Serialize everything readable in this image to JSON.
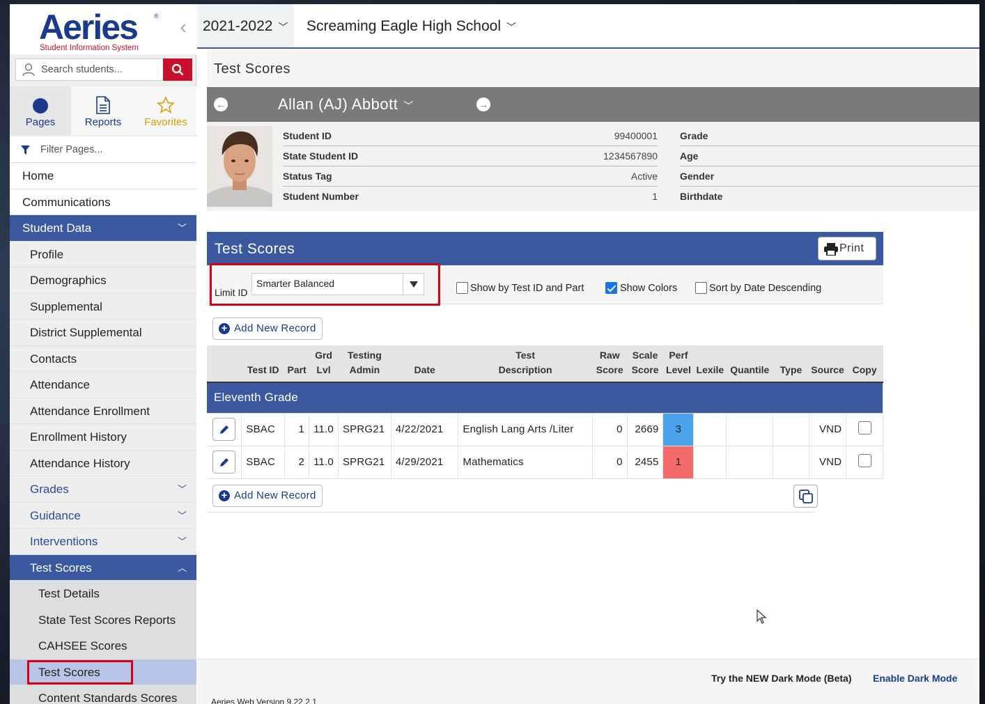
{
  "app": {
    "logo_text": "Aeries",
    "logo_subtitle": "Student Information System",
    "logo_reg": "®"
  },
  "search": {
    "placeholder": "Search students..."
  },
  "nav_tabs": {
    "pages": "Pages",
    "reports": "Reports",
    "favorites": "Favorites"
  },
  "filter_pages": "Filter Pages...",
  "sidebar": {
    "items": [
      {
        "label": "Home"
      },
      {
        "label": "Communications"
      },
      {
        "label": "Student Data"
      },
      {
        "label": "Profile"
      },
      {
        "label": "Demographics"
      },
      {
        "label": "Supplemental"
      },
      {
        "label": "District Supplemental"
      },
      {
        "label": "Contacts"
      },
      {
        "label": "Attendance"
      },
      {
        "label": "Attendance Enrollment"
      },
      {
        "label": "Enrollment History"
      },
      {
        "label": "Attendance History"
      },
      {
        "label": "Grades"
      },
      {
        "label": "Guidance"
      },
      {
        "label": "Interventions"
      },
      {
        "label": "Test Scores"
      },
      {
        "label": "Test Details"
      },
      {
        "label": "State Test Scores Reports"
      },
      {
        "label": "CAHSEE Scores"
      },
      {
        "label": "Test Scores"
      },
      {
        "label": "Content Standards Scores"
      }
    ]
  },
  "topbar": {
    "year": "2021-2022",
    "school": "Screaming Eagle High School"
  },
  "page_title": "Test Scores",
  "student": {
    "name": "Allan (AJ) Abbott",
    "fields_left": [
      {
        "label": "Student ID",
        "value": "99400001"
      },
      {
        "label": "State Student ID",
        "value": "1234567890"
      },
      {
        "label": "Status Tag",
        "value": "Active"
      },
      {
        "label": "Student Number",
        "value": "1"
      }
    ],
    "fields_right": [
      {
        "label": "Grade"
      },
      {
        "label": "Age"
      },
      {
        "label": "Gender"
      },
      {
        "label": "Birthdate"
      }
    ]
  },
  "test_scores": {
    "title": "Test Scores",
    "print_label": "Print",
    "limit_label": "Limit ID",
    "limit_value": "Smarter Balanced",
    "options": {
      "by_test_id": "Show by Test ID and Part",
      "show_colors": "Show Colors",
      "sort_desc": "Sort by Date Descending"
    },
    "option_state": {
      "by_test_id": false,
      "show_colors": true,
      "sort_desc": false
    },
    "add_new_label": "Add New Record",
    "columns": [
      {
        "line1": "",
        "line2": "Test ID"
      },
      {
        "line1": "",
        "line2": "Part"
      },
      {
        "line1": "Grd",
        "line2": "Lvl"
      },
      {
        "line1": "Testing",
        "line2": "Admin"
      },
      {
        "line1": "",
        "line2": "Date"
      },
      {
        "line1": "Test",
        "line2": "Description"
      },
      {
        "line1": "Raw",
        "line2": "Score"
      },
      {
        "line1": "Scale",
        "line2": "Score"
      },
      {
        "line1": "Perf",
        "line2": "Level"
      },
      {
        "line1": "",
        "line2": "Lexile"
      },
      {
        "line1": "",
        "line2": "Quantile"
      },
      {
        "line1": "",
        "line2": "Type"
      },
      {
        "line1": "",
        "line2": "Source"
      },
      {
        "line1": "",
        "line2": "Copy"
      }
    ],
    "group_label": "Eleventh Grade",
    "rows": [
      {
        "test_id": "SBAC",
        "part": "1",
        "grade": "11.0",
        "admin": "SPRG21",
        "date": "4/22/2021",
        "description": "English Lang Arts /Liter",
        "raw": "0",
        "scale": "2669",
        "perf": "3",
        "lexile": "",
        "quantile": "",
        "type": "",
        "source": "VND",
        "perf_color": "#4aa3ea"
      },
      {
        "test_id": "SBAC",
        "part": "2",
        "grade": "11.0",
        "admin": "SPRG21",
        "date": "4/29/2021",
        "description": "Mathematics",
        "raw": "0",
        "scale": "2455",
        "perf": "1",
        "lexile": "",
        "quantile": "",
        "type": "",
        "source": "VND",
        "perf_color": "#f46b6b"
      }
    ]
  },
  "footer": {
    "dark_try": "Try the NEW Dark Mode (Beta)",
    "dark_link": "Enable Dark Mode",
    "version": "Aeries Web Version 9.22.2.1"
  },
  "colors": {
    "brand_blue": "#3a59a0",
    "accent_red": "#c8102e",
    "highlight_red": "#d7000f"
  }
}
